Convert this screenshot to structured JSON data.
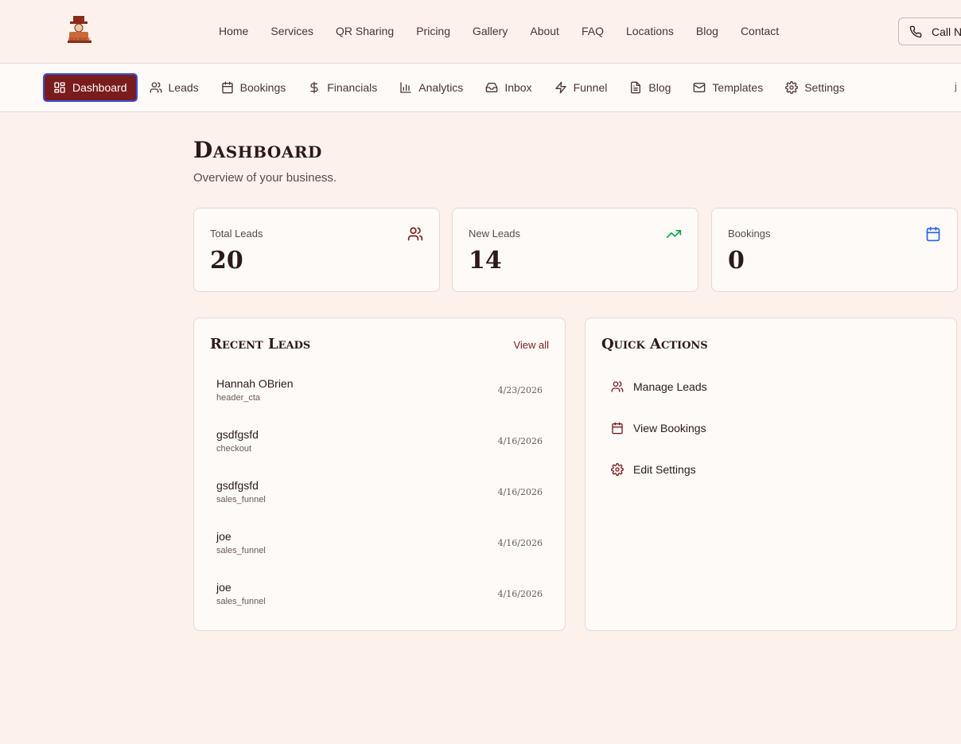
{
  "topnav": {
    "logo_text": "RED ROCK",
    "links": [
      "Home",
      "Services",
      "QR Sharing",
      "Pricing",
      "Gallery",
      "About",
      "FAQ",
      "Locations",
      "Blog",
      "Contact"
    ],
    "call_label": "Call N"
  },
  "adminnav": {
    "items": [
      {
        "label": "Dashboard",
        "icon": "layout-dashboard-icon"
      },
      {
        "label": "Leads",
        "icon": "users-icon"
      },
      {
        "label": "Bookings",
        "icon": "calendar-icon"
      },
      {
        "label": "Financials",
        "icon": "dollar-sign-icon"
      },
      {
        "label": "Analytics",
        "icon": "bar-chart-icon"
      },
      {
        "label": "Inbox",
        "icon": "inbox-icon"
      },
      {
        "label": "Funnel",
        "icon": "zap-icon"
      },
      {
        "label": "Blog",
        "icon": "file-text-icon"
      },
      {
        "label": "Templates",
        "icon": "mail-icon"
      },
      {
        "label": "Settings",
        "icon": "settings-icon"
      }
    ],
    "user_truncated": "j"
  },
  "page": {
    "title": "Dashboard",
    "subtitle": "Overview of your business."
  },
  "stats": [
    {
      "label": "Total Leads",
      "value": "20",
      "icon": "users-icon",
      "color": "#7a1c1c"
    },
    {
      "label": "New Leads",
      "value": "14",
      "icon": "trending-up-icon",
      "color": "#16a34a"
    },
    {
      "label": "Bookings",
      "value": "0",
      "icon": "calendar-icon",
      "color": "#2563eb"
    }
  ],
  "recent_leads": {
    "title": "Recent Leads",
    "view_all": "View all",
    "rows": [
      {
        "name": "Hannah OBrien",
        "source": "header_cta",
        "date": "4/23/2026"
      },
      {
        "name": "gsdfgsfd",
        "source": "checkout",
        "date": "4/16/2026"
      },
      {
        "name": "gsdfgsfd",
        "source": "sales_funnel",
        "date": "4/16/2026"
      },
      {
        "name": "joe",
        "source": "sales_funnel",
        "date": "4/16/2026"
      },
      {
        "name": "joe",
        "source": "sales_funnel",
        "date": "4/16/2026"
      }
    ]
  },
  "quick_actions": {
    "title": "Quick Actions",
    "items": [
      {
        "label": "Manage Leads",
        "icon": "users-icon"
      },
      {
        "label": "View Bookings",
        "icon": "calendar-icon"
      },
      {
        "label": "Edit Settings",
        "icon": "settings-icon"
      }
    ]
  },
  "colors": {
    "accent": "#7a1c1c",
    "background": "#fdf1ec",
    "card": "#fdfaf8"
  }
}
